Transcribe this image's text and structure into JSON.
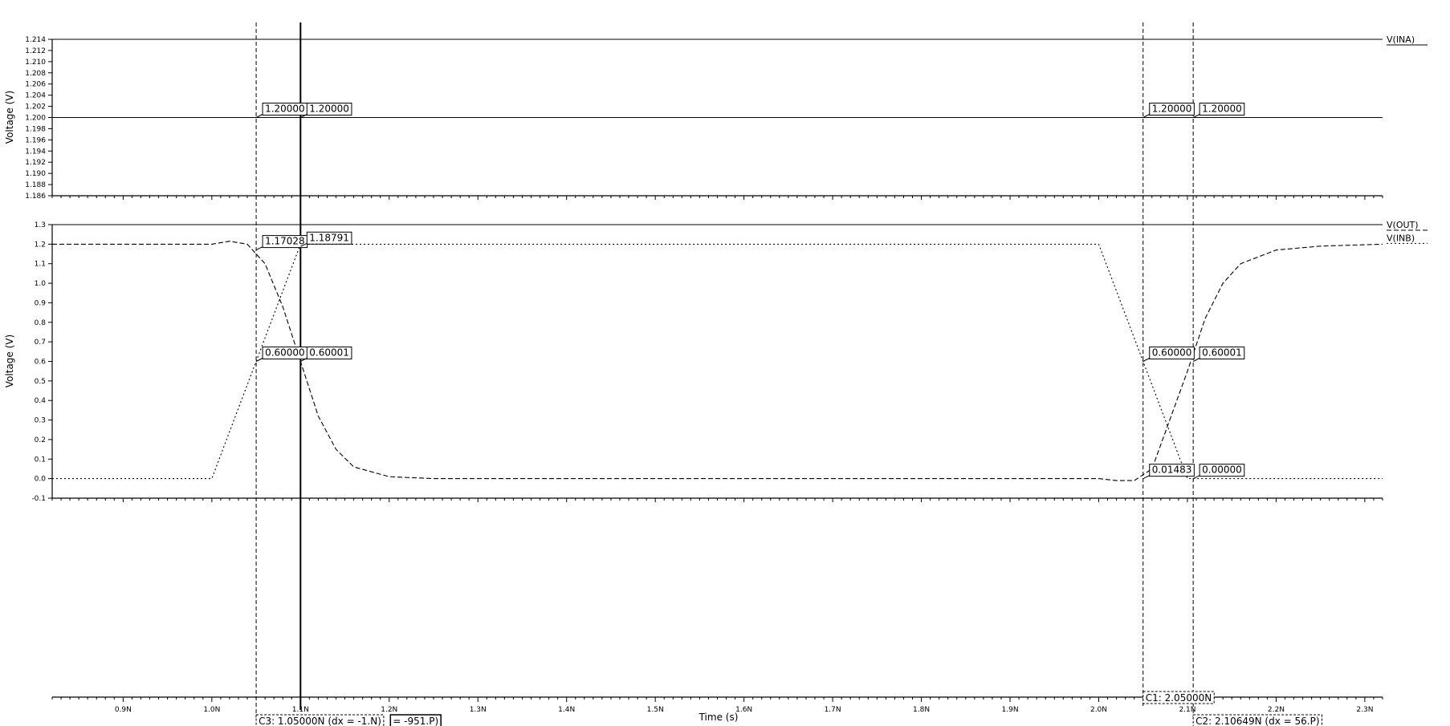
{
  "chart_data": [
    {
      "type": "line",
      "panel": "top",
      "ylabel": "Voltage (V)",
      "ylim": [
        1.186,
        1.214
      ],
      "yticks": [
        "1.186",
        "1.188",
        "1.190",
        "1.192",
        "1.194",
        "1.196",
        "1.198",
        "1.200",
        "1.202",
        "1.204",
        "1.206",
        "1.208",
        "1.210",
        "1.212",
        "1.214"
      ],
      "series": [
        {
          "name": "V(INA)",
          "style": "solid",
          "x": [
            0.82,
            2.32
          ],
          "y": [
            1.2,
            1.2
          ]
        }
      ],
      "markers": [
        {
          "x": 1.05,
          "y": 1.2,
          "label": "1.20000"
        },
        {
          "x": 1.1,
          "y": 1.2,
          "label": "1.20000"
        },
        {
          "x": 2.05,
          "y": 1.2,
          "label": "1.20000"
        },
        {
          "x": 2.10649,
          "y": 1.2,
          "label": "1.20000"
        }
      ]
    },
    {
      "type": "line",
      "panel": "bottom",
      "ylabel": "Voltage (V)",
      "ylim": [
        -0.1,
        1.3
      ],
      "yticks": [
        "-0.1",
        "0.0",
        "0.1",
        "0.2",
        "0.3",
        "0.4",
        "0.5",
        "0.6",
        "0.7",
        "0.8",
        "0.9",
        "1.0",
        "1.1",
        "1.2",
        "1.3"
      ],
      "series": [
        {
          "name": "V(OUT)",
          "style": "dashed",
          "x": [
            0.82,
            1.0,
            1.02,
            1.04,
            1.06,
            1.08,
            1.1,
            1.12,
            1.14,
            1.16,
            1.2,
            1.25,
            1.3,
            1.5,
            2.0,
            2.02,
            2.04,
            2.06,
            2.08,
            2.1,
            2.12,
            2.14,
            2.16,
            2.2,
            2.25,
            2.32
          ],
          "y": [
            1.2,
            1.2,
            1.215,
            1.2,
            1.1,
            0.88,
            0.6,
            0.32,
            0.15,
            0.06,
            0.01,
            0.0,
            0.0,
            0.0,
            0.0,
            -0.01,
            -0.01,
            0.05,
            0.3,
            0.55,
            0.82,
            1.0,
            1.1,
            1.17,
            1.19,
            1.2
          ]
        },
        {
          "name": "V(INB)",
          "style": "dotted",
          "x": [
            0.82,
            1.0,
            1.1,
            2.0,
            2.1,
            2.32
          ],
          "y": [
            0.0,
            0.0,
            1.2,
            1.2,
            0.0,
            0.0
          ]
        }
      ],
      "markers": [
        {
          "x": 1.05,
          "y": 1.17028,
          "label": "1.17028"
        },
        {
          "x": 1.1,
          "y": 1.18791,
          "label": "1.18791"
        },
        {
          "x": 1.05,
          "y": 0.6,
          "label": "0.60000"
        },
        {
          "x": 1.1,
          "y": 0.6,
          "label": "0.60001"
        },
        {
          "x": 2.05,
          "y": 0.6,
          "label": "0.60000"
        },
        {
          "x": 2.10649,
          "y": 0.6,
          "label": "0.60001"
        },
        {
          "x": 2.05,
          "y": 0.0,
          "label": "0.01483"
        },
        {
          "x": 2.10649,
          "y": 0.0,
          "label": "0.00000"
        }
      ]
    }
  ],
  "x_axis": {
    "xlabel": "Time (s)",
    "xlim": [
      0.82,
      2.32
    ],
    "ticks": [
      {
        "x": 0.9,
        "label": "0.9N"
      },
      {
        "x": 1.0,
        "label": "1.0N"
      },
      {
        "x": 1.1,
        "label": "1.1N"
      },
      {
        "x": 1.2,
        "label": "1.2N"
      },
      {
        "x": 1.3,
        "label": "1.3N"
      },
      {
        "x": 1.4,
        "label": "1.4N"
      },
      {
        "x": 1.5,
        "label": "1.5N"
      },
      {
        "x": 1.6,
        "label": "1.6N"
      },
      {
        "x": 1.7,
        "label": "1.7N"
      },
      {
        "x": 1.8,
        "label": "1.8N"
      },
      {
        "x": 1.9,
        "label": "1.9N"
      },
      {
        "x": 2.0,
        "label": "2.0N"
      },
      {
        "x": 2.1,
        "label": "2.1N"
      },
      {
        "x": 2.2,
        "label": "2.2N"
      },
      {
        "x": 2.3,
        "label": "2.3N"
      }
    ]
  },
  "cursors": [
    {
      "id": "C1",
      "x": 2.05,
      "style": "dashed",
      "label": "C1: 2.05000N"
    },
    {
      "id": "C2",
      "x": 2.10649,
      "style": "dashed",
      "label": "C2: 2.10649N (dx = 56.P)"
    },
    {
      "id": "C3",
      "x": 1.05,
      "style": "dashed",
      "label": "C3: 1.05000N (dx = -1.N)"
    },
    {
      "id": "C4",
      "x": 1.1,
      "style": "solid",
      "label": "= -951.P)"
    }
  ]
}
